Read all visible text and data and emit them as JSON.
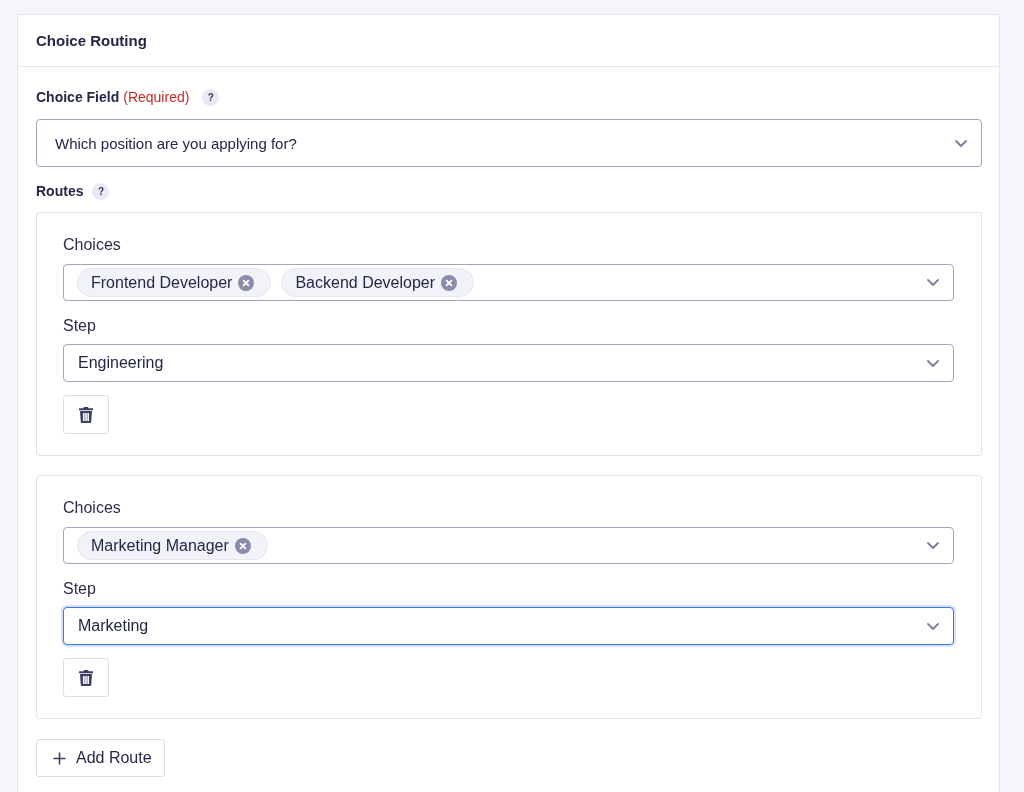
{
  "panel": {
    "title": "Choice Routing"
  },
  "choice_field": {
    "label": "Choice Field",
    "required_note": "(Required)",
    "help": "?",
    "value": "Which position are you applying for?"
  },
  "routes_section": {
    "label": "Routes",
    "help": "?"
  },
  "routes": [
    {
      "choices_label": "Choices",
      "choices": [
        {
          "label": "Frontend Developer"
        },
        {
          "label": "Backend Developer"
        }
      ],
      "step_label": "Step",
      "step": {
        "value": "Engineering",
        "focused": false
      }
    },
    {
      "choices_label": "Choices",
      "choices": [
        {
          "label": "Marketing Manager"
        }
      ],
      "step_label": "Step",
      "step": {
        "value": "Marketing",
        "focused": true
      }
    }
  ],
  "add_button": {
    "label": "Add Route"
  }
}
